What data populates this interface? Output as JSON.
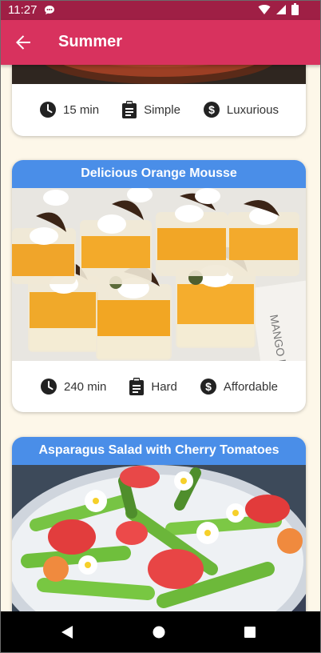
{
  "status_bar": {
    "time": "11:27",
    "icons": [
      "chat-bubble-icon",
      "wifi-icon",
      "cellular-signal-icon",
      "battery-icon"
    ]
  },
  "app_bar": {
    "title": "Summer",
    "back_icon": "arrow-back-icon"
  },
  "recipes": [
    {
      "title": "",
      "duration": "15 min",
      "complexity": "Simple",
      "affordability": "Luxurious"
    },
    {
      "title": "Delicious Orange Mousse",
      "duration": "240 min",
      "complexity": "Hard",
      "affordability": "Affordable",
      "image_text": "MANGO PU"
    },
    {
      "title": "Asparagus Salad with Cherry Tomatoes"
    }
  ],
  "colors": {
    "status_bar": "#9f1f45",
    "app_bar": "#d8325e",
    "card_title": "#4a8ee8",
    "background": "#fdf7e9"
  },
  "nav_bar": {
    "icons": [
      "back-triangle-icon",
      "home-circle-icon",
      "recents-square-icon"
    ]
  }
}
